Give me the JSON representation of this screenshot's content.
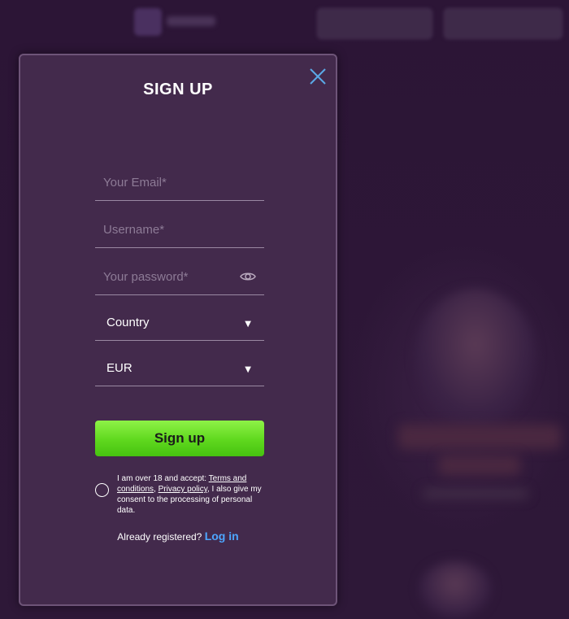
{
  "modal": {
    "title": "SIGN UP",
    "fields": {
      "email_placeholder": "Your Email*",
      "username_placeholder": "Username*",
      "password_placeholder": "Your password*"
    },
    "selects": {
      "country_value": "Country",
      "currency_value": "EUR"
    },
    "submit_label": "Sign up",
    "consent": {
      "prefix": "I am over 18 and accept: ",
      "terms_link": "Terms and conditions",
      "comma": ", ",
      "privacy_link": "Privacy policy",
      "suffix": ", I also give my consent to the processing of personal data."
    },
    "login": {
      "prompt": "Already registered? ",
      "link": "Log in"
    },
    "icons": {
      "close": "close-icon",
      "eye": "eye-icon",
      "dropdown": "chevron-down-icon"
    },
    "colors": {
      "accent_green": "#5fd81e",
      "link_blue": "#4da6ff",
      "close_blue": "#5aa9e6"
    }
  }
}
